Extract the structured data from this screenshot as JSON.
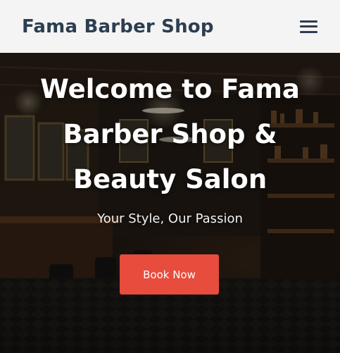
{
  "header": {
    "brand": "Fama Barber Shop",
    "menu_icon": "hamburger-menu-icon"
  },
  "hero": {
    "title_line1": "Welcome to Fama",
    "title_line2": "Barber Shop &",
    "title_line3": "Beauty Salon",
    "subtitle": "Your Style, Our Passion",
    "cta_label": "Book Now",
    "background_image": "barbershop-interior"
  },
  "colors": {
    "header_bg": "#f4f4f4",
    "brand_text": "#2c3e50",
    "cta_bg": "#e74c3c",
    "hero_text": "#ffffff"
  }
}
